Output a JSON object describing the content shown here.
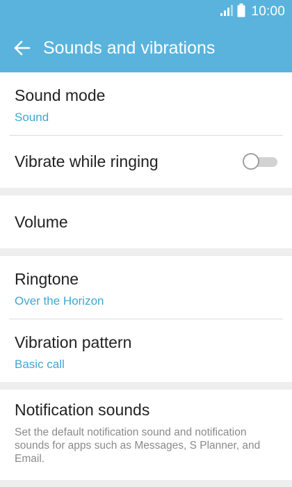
{
  "status_bar": {
    "time": "10:00",
    "icons": [
      "signal-icon",
      "battery-icon"
    ]
  },
  "app_bar": {
    "title": "Sounds and vibrations",
    "back_icon": "arrow-left-icon"
  },
  "colors": {
    "header": "#5ab3dc",
    "accent": "#3fa7cf",
    "background": "#eeeeee"
  },
  "items": {
    "sound_mode": {
      "label": "Sound mode",
      "value": "Sound"
    },
    "vibrate_while_ringing": {
      "label": "Vibrate while ringing",
      "enabled": false
    },
    "volume": {
      "label": "Volume"
    },
    "ringtone": {
      "label": "Ringtone",
      "value": "Over the Horizon"
    },
    "vibration_pattern": {
      "label": "Vibration pattern",
      "value": "Basic call"
    },
    "notification_sounds": {
      "label": "Notification sounds",
      "description": "Set the default notification sound and notification sounds for apps such as Messages, S Planner, and Email."
    }
  }
}
